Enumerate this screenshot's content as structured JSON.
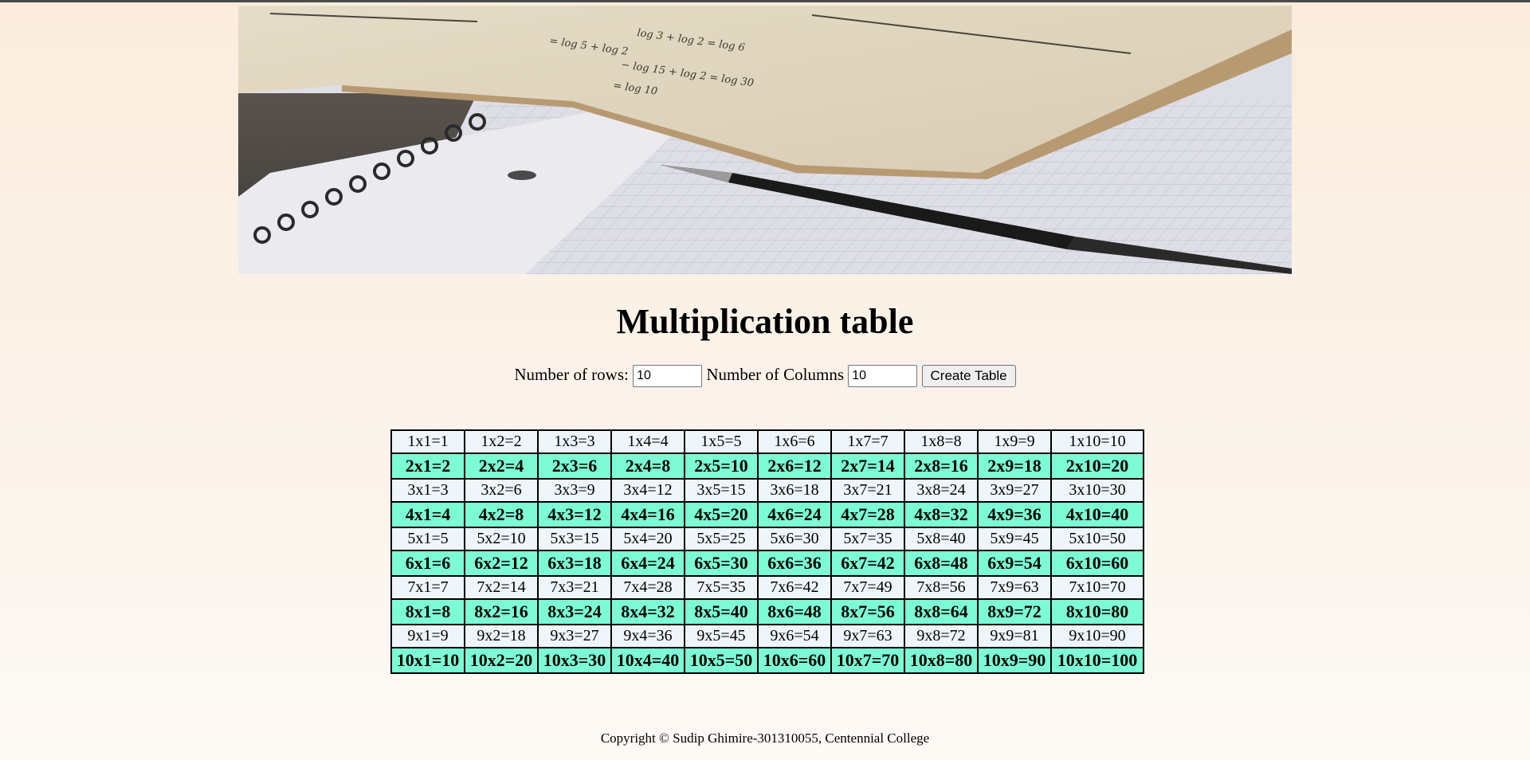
{
  "page": {
    "title": "Multiplication table",
    "footer": "Copyright © Sudip Ghimire-301310055, Centennial College"
  },
  "hero": {
    "alt": "Open math book with notebook and pen on graph paper",
    "book_text_lines": [
      "= log 5 + log 2",
      "= log 10",
      "log 3 + log 2 = log 6",
      "− log 15 + log 2 = log 30"
    ]
  },
  "form": {
    "rows_label": "Number of rows:",
    "rows_value": "10",
    "cols_label": "Number of Columns",
    "cols_value": "10",
    "create_button": "Create Table"
  },
  "table": {
    "rows": 10,
    "columns": 10,
    "colors": {
      "odd_row_bg": "#eef6fc",
      "even_row_bg": "#7dfcd3",
      "border": "#000000"
    },
    "cells": [
      [
        "1x1=1",
        "1x2=2",
        "1x3=3",
        "1x4=4",
        "1x5=5",
        "1x6=6",
        "1x7=7",
        "1x8=8",
        "1x9=9",
        "1x10=10"
      ],
      [
        "2x1=2",
        "2x2=4",
        "2x3=6",
        "2x4=8",
        "2x5=10",
        "2x6=12",
        "2x7=14",
        "2x8=16",
        "2x9=18",
        "2x10=20"
      ],
      [
        "3x1=3",
        "3x2=6",
        "3x3=9",
        "3x4=12",
        "3x5=15",
        "3x6=18",
        "3x7=21",
        "3x8=24",
        "3x9=27",
        "3x10=30"
      ],
      [
        "4x1=4",
        "4x2=8",
        "4x3=12",
        "4x4=16",
        "4x5=20",
        "4x6=24",
        "4x7=28",
        "4x8=32",
        "4x9=36",
        "4x10=40"
      ],
      [
        "5x1=5",
        "5x2=10",
        "5x3=15",
        "5x4=20",
        "5x5=25",
        "5x6=30",
        "5x7=35",
        "5x8=40",
        "5x9=45",
        "5x10=50"
      ],
      [
        "6x1=6",
        "6x2=12",
        "6x3=18",
        "6x4=24",
        "6x5=30",
        "6x6=36",
        "6x7=42",
        "6x8=48",
        "6x9=54",
        "6x10=60"
      ],
      [
        "7x1=7",
        "7x2=14",
        "7x3=21",
        "7x4=28",
        "7x5=35",
        "7x6=42",
        "7x7=49",
        "7x8=56",
        "7x9=63",
        "7x10=70"
      ],
      [
        "8x1=8",
        "8x2=16",
        "8x3=24",
        "8x4=32",
        "8x5=40",
        "8x6=48",
        "8x7=56",
        "8x8=64",
        "8x9=72",
        "8x10=80"
      ],
      [
        "9x1=9",
        "9x2=18",
        "9x3=27",
        "9x4=36",
        "9x5=45",
        "9x6=54",
        "9x7=63",
        "9x8=72",
        "9x9=81",
        "9x10=90"
      ],
      [
        "10x1=10",
        "10x2=20",
        "10x3=30",
        "10x4=40",
        "10x5=50",
        "10x6=60",
        "10x7=70",
        "10x8=80",
        "10x9=90",
        "10x10=100"
      ]
    ]
  }
}
